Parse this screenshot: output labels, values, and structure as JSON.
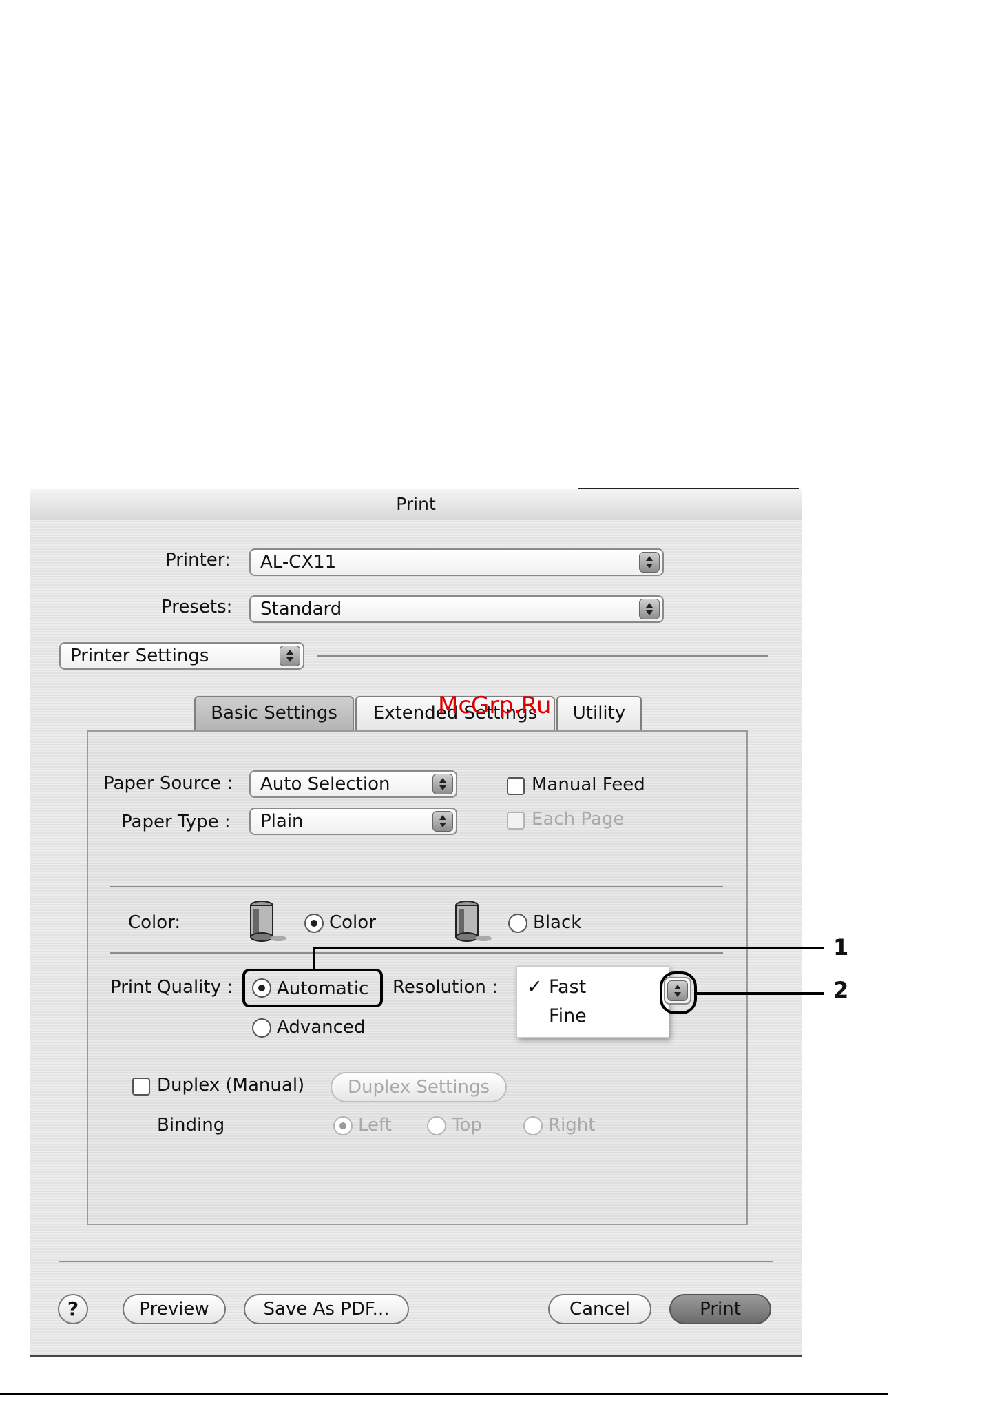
{
  "window": {
    "title": "Print"
  },
  "printer": {
    "label": "Printer:",
    "value": "AL-CX11"
  },
  "presets": {
    "label": "Presets:",
    "value": "Standard"
  },
  "panel_menu": {
    "value": "Printer Settings"
  },
  "tabs": [
    {
      "label": "Basic Settings",
      "active": true
    },
    {
      "label": "Extended Settings",
      "active": false
    },
    {
      "label": "Utility",
      "active": false
    }
  ],
  "watermark": "McGrp.Ru",
  "paper_source": {
    "label": "Paper Source :",
    "value": "Auto Selection"
  },
  "paper_type": {
    "label": "Paper Type :",
    "value": "Plain"
  },
  "manual_feed": {
    "label": "Manual Feed"
  },
  "each_page": {
    "label": "Each Page"
  },
  "color": {
    "label": "Color:",
    "color_option": "Color",
    "black_option": "Black",
    "selected": "Color"
  },
  "print_quality": {
    "label": "Print Quality :",
    "automatic": "Automatic",
    "advanced": "Advanced",
    "selected": "Automatic"
  },
  "resolution": {
    "label": "Resolution :",
    "options": [
      "Fast",
      "Fine"
    ],
    "selected": "Fast",
    "check_mark": "✓"
  },
  "duplex": {
    "label": "Duplex (Manual)",
    "settings_button": "Duplex Settings"
  },
  "binding": {
    "label": "Binding",
    "left": "Left",
    "top": "Top",
    "right": "Right",
    "selected": "Left"
  },
  "callouts": [
    "1",
    "2"
  ],
  "buttons": {
    "help": "?",
    "preview": "Preview",
    "save_pdf": "Save As PDF...",
    "cancel": "Cancel",
    "print": "Print"
  }
}
